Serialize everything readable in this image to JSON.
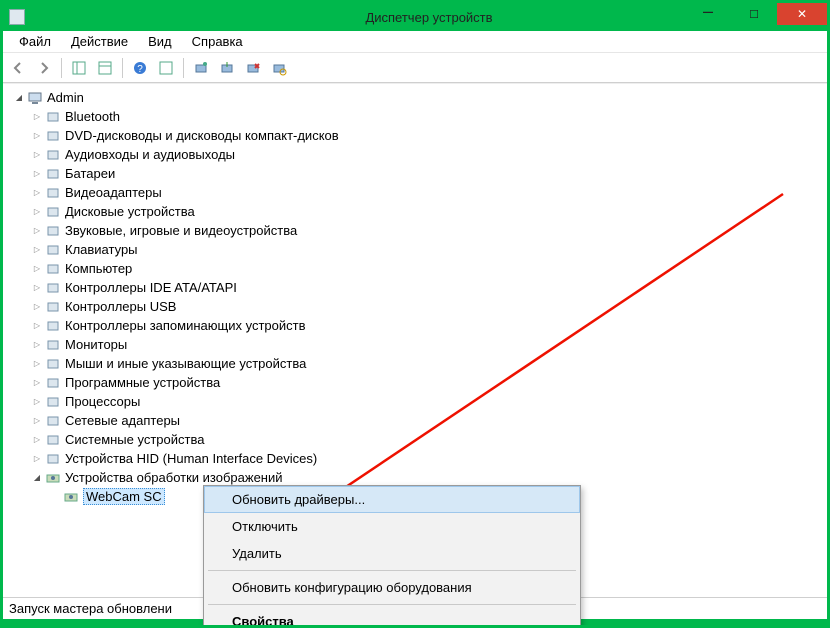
{
  "window": {
    "title": "Диспетчер устройств"
  },
  "menu": {
    "file": "Файл",
    "action": "Действие",
    "view": "Вид",
    "help": "Справка"
  },
  "tree": {
    "root": "Admin",
    "items": [
      "Bluetooth",
      "DVD-дисководы и дисководы компакт-дисков",
      "Аудиовходы и аудиовыходы",
      "Батареи",
      "Видеоадаптеры",
      "Дисковые устройства",
      "Звуковые, игровые и видеоустройства",
      "Клавиатуры",
      "Компьютер",
      "Контроллеры IDE ATA/ATAPI",
      "Контроллеры USB",
      "Контроллеры запоминающих устройств",
      "Мониторы",
      "Мыши и иные указывающие устройства",
      "Программные устройства",
      "Процессоры",
      "Сетевые адаптеры",
      "Системные устройства",
      "Устройства HID (Human Interface Devices)"
    ],
    "imaging": {
      "label": "Устройства обработки изображений",
      "child": "WebCam SC"
    }
  },
  "context_menu": {
    "update": "Обновить драйверы...",
    "disable": "Отключить",
    "delete": "Удалить",
    "rescan": "Обновить конфигурацию оборудования",
    "props": "Свойства"
  },
  "status": "Запуск мастера обновлени"
}
